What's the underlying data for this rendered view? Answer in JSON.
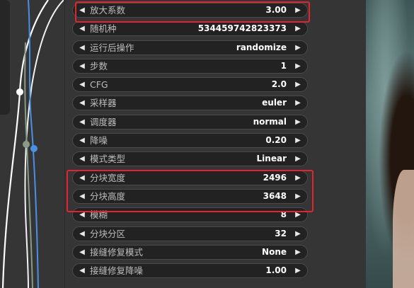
{
  "colors": {
    "highlight": "#e0252f",
    "wire_white": "#ffffff",
    "wire_blue": "#4a90e2",
    "wire_gray": "#8a9a86"
  },
  "icons": {
    "decrement": "◀",
    "increment": "▶"
  },
  "widgets": [
    {
      "label": "放大系数",
      "value": "3.00"
    },
    {
      "label": "随机种",
      "value": "534459742823373"
    },
    {
      "label": "运行后操作",
      "value": "randomize"
    },
    {
      "label": "步数",
      "value": "1"
    },
    {
      "label": "CFG",
      "value": "2.0"
    },
    {
      "label": "采样器",
      "value": "euler"
    },
    {
      "label": "调度器",
      "value": "normal"
    },
    {
      "label": "降噪",
      "value": "0.20"
    },
    {
      "label": "模式类型",
      "value": "Linear"
    },
    {
      "label": "分块宽度",
      "value": "2496"
    },
    {
      "label": "分块高度",
      "value": "3648"
    },
    {
      "label": "模糊",
      "value": "8"
    },
    {
      "label": "分块分区",
      "value": "32"
    },
    {
      "label": "接缝修复模式",
      "value": "None"
    },
    {
      "label": "接缝修复降噪",
      "value": "1.00"
    }
  ]
}
